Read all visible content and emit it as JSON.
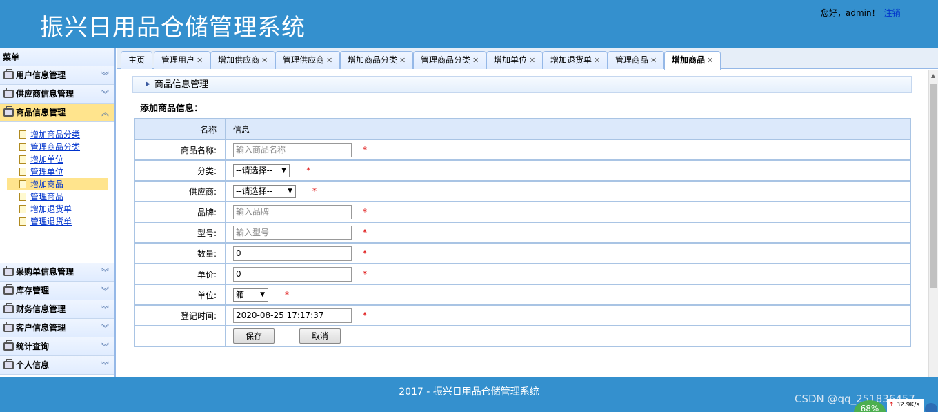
{
  "header": {
    "title": "振兴日用品仓储管理系统",
    "greeting": "您好，admin！",
    "logout": "注销"
  },
  "sidebar": {
    "title": "菜单",
    "groups_top": [
      {
        "label": "用户信息管理"
      },
      {
        "label": "供应商信息管理"
      },
      {
        "label": "商品信息管理",
        "selected": true
      }
    ],
    "sub_items": [
      {
        "label": "增加商品分类"
      },
      {
        "label": "管理商品分类"
      },
      {
        "label": "增加单位"
      },
      {
        "label": "管理单位"
      },
      {
        "label": "增加商品",
        "selected": true
      },
      {
        "label": "管理商品"
      },
      {
        "label": "增加退货单"
      },
      {
        "label": "管理退货单"
      }
    ],
    "groups_bottom": [
      {
        "label": "采购单信息管理"
      },
      {
        "label": "库存管理"
      },
      {
        "label": "财务信息管理"
      },
      {
        "label": "客户信息管理"
      },
      {
        "label": "统计查询"
      },
      {
        "label": "个人信息"
      }
    ]
  },
  "tabs": [
    {
      "label": "主页",
      "closable": false
    },
    {
      "label": "管理用户",
      "closable": true
    },
    {
      "label": "增加供应商",
      "closable": true
    },
    {
      "label": "管理供应商",
      "closable": true
    },
    {
      "label": "增加商品分类",
      "closable": true
    },
    {
      "label": "管理商品分类",
      "closable": true
    },
    {
      "label": "增加单位",
      "closable": true
    },
    {
      "label": "增加退货单",
      "closable": true
    },
    {
      "label": "管理商品",
      "closable": true
    },
    {
      "label": "增加商品",
      "closable": true,
      "active": true
    }
  ],
  "panel": {
    "title": "商品信息管理",
    "form_title": "添加商品信息："
  },
  "form": {
    "header": {
      "name": "名称",
      "info": "信息"
    },
    "required_mark": "*",
    "fields": {
      "name": {
        "label": "商品名称:",
        "placeholder": "输入商品名称"
      },
      "category": {
        "label": "分类:",
        "value": "--请选择--"
      },
      "supplier": {
        "label": "供应商:",
        "value": "--请选择--"
      },
      "brand": {
        "label": "品牌:",
        "placeholder": "输入品牌"
      },
      "model": {
        "label": "型号:",
        "placeholder": "输入型号"
      },
      "quantity": {
        "label": "数量:",
        "value": "0"
      },
      "price": {
        "label": "单价:",
        "value": "0"
      },
      "unit": {
        "label": "单位:",
        "value": "箱"
      },
      "time": {
        "label": "登记时间:",
        "value": "2020-08-25 17:17:37"
      }
    },
    "save_label": "保存",
    "cancel_label": "取消"
  },
  "footer": {
    "text": "2017 - 振兴日用品仓储管理系统",
    "watermark": "CSDN @qq_251836457",
    "badge": "68%",
    "speed": "32.9K/s"
  },
  "colors": {
    "header": "#3490ce",
    "tab_border": "#95b8e7",
    "selected": "#ffe48d",
    "required": "#dd0000"
  }
}
